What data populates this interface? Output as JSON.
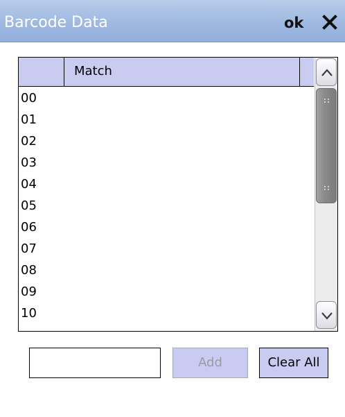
{
  "window": {
    "title": "Barcode Data",
    "ok_label": "ok",
    "close_icon": "close-icon"
  },
  "table": {
    "columns": [
      "",
      "Match",
      ""
    ],
    "rows": [
      "00",
      "01",
      "02",
      "03",
      "04",
      "05",
      "06",
      "07",
      "08",
      "09",
      "10"
    ]
  },
  "scrollbar": {
    "up_icon": "chevron-up-icon",
    "down_icon": "chevron-down-icon"
  },
  "controls": {
    "input_value": "",
    "add_label": "Add",
    "add_enabled": false,
    "clear_label": "Clear All"
  },
  "colors": {
    "titlebar": "#9fb9e1",
    "header": "#c9cbf1",
    "button": "#c9cbf1"
  }
}
